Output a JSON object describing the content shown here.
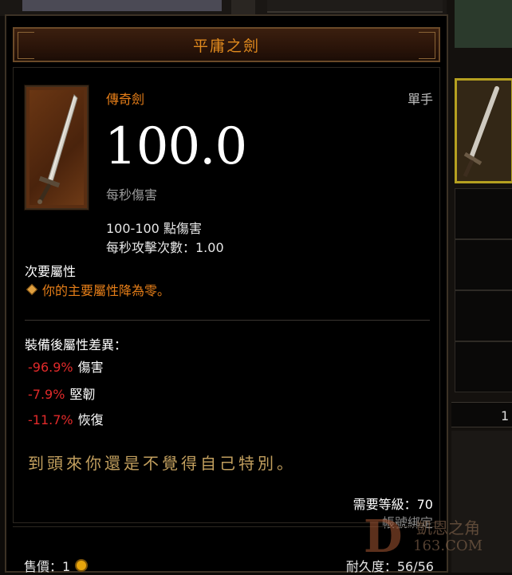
{
  "item": {
    "name": "平庸之劍",
    "type": "傳奇劍",
    "hand": "單手",
    "dps_value": "100.0",
    "dps_label": "每秒傷害",
    "damage_range": "100-100 點傷害",
    "attack_speed": "每秒攻擊次數：1.00",
    "icon": "sword-icon"
  },
  "secondary": {
    "header": "次要屬性",
    "affix": "你的主要屬性降為零。"
  },
  "comparison": {
    "header": "裝備後屬性差異：",
    "rows": [
      {
        "value": "-96.9%",
        "label": "傷害"
      },
      {
        "value": "-7.9%",
        "label": "堅韌"
      },
      {
        "value": "-11.7%",
        "label": "恢復"
      }
    ]
  },
  "flavor": "到頭來你還是不覺得自己特別。",
  "requirements": {
    "level": "需要等級：70",
    "bound": "帳號綁定"
  },
  "footer": {
    "price": "售價：1",
    "durability": "耐久度：56/56"
  },
  "right_panel": {
    "slot_text": "1"
  },
  "watermark": {
    "letter": "D",
    "chinese": "凱恩之角",
    "site": "163.COM"
  },
  "colors": {
    "title": "#e08a1e",
    "legendary": "#e67e18",
    "negative": "#e12a2a",
    "flavor": "#c29f5e"
  }
}
